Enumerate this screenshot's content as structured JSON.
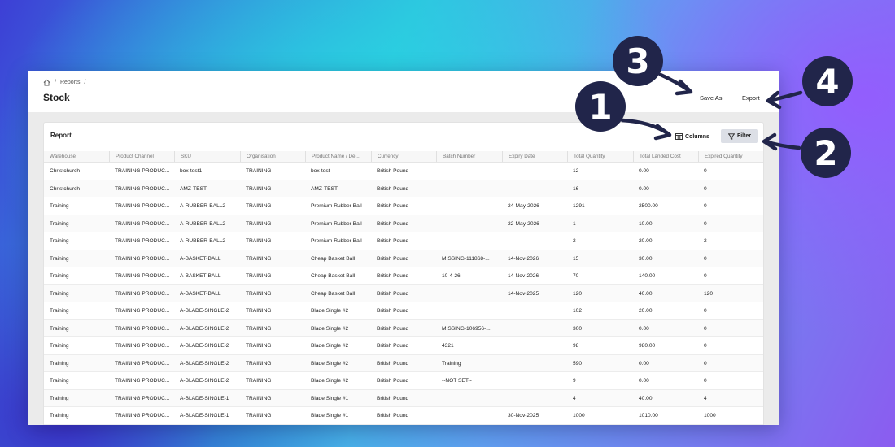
{
  "breadcrumb": {
    "reports": "Reports",
    "sep1": "/",
    "sep2": "/"
  },
  "page": {
    "title": "Stock"
  },
  "header_actions": {
    "save_as": "Save As",
    "export": "Export"
  },
  "report": {
    "title": "Report",
    "columns_label": "Columns",
    "filter_label": "Filter"
  },
  "table": {
    "headers": [
      "Warehouse",
      "Product Channel",
      "SKU",
      "Organisation",
      "Product Name / De...",
      "Currency",
      "Batch Number",
      "Expiry Date",
      "Total Quantity",
      "Total Landed Cost",
      "Expired Quantity"
    ],
    "rows": [
      [
        "Christchurch",
        "TRAINING PRODUC...",
        "box-test1",
        "TRAINING",
        "box-test",
        "British Pound",
        "",
        "",
        "12",
        "0.00",
        "0"
      ],
      [
        "Christchurch",
        "TRAINING PRODUC...",
        "AMZ-TEST",
        "TRAINING",
        "AMZ-TEST",
        "British Pound",
        "",
        "",
        "16",
        "0.00",
        "0"
      ],
      [
        "Training",
        "TRAINING PRODUC...",
        "A-RUBBER-BALL2",
        "TRAINING",
        "Premium Rubber Ball",
        "British Pound",
        "",
        "24-May-2026",
        "1291",
        "2500.00",
        "0"
      ],
      [
        "Training",
        "TRAINING PRODUC...",
        "A-RUBBER-BALL2",
        "TRAINING",
        "Premium Rubber Ball",
        "British Pound",
        "",
        "22-May-2026",
        "1",
        "10.00",
        "0"
      ],
      [
        "Training",
        "TRAINING PRODUC...",
        "A-RUBBER-BALL2",
        "TRAINING",
        "Premium Rubber Ball",
        "British Pound",
        "",
        "",
        "2",
        "20.00",
        "2"
      ],
      [
        "Training",
        "TRAINING PRODUC...",
        "A-BASKET-BALL",
        "TRAINING",
        "Cheap Basket Ball",
        "British Pound",
        "MISSING-111868-...",
        "14-Nov-2026",
        "15",
        "30.00",
        "0"
      ],
      [
        "Training",
        "TRAINING PRODUC...",
        "A-BASKET-BALL",
        "TRAINING",
        "Cheap Basket Ball",
        "British Pound",
        "10-4-26",
        "14-Nov-2026",
        "70",
        "140.00",
        "0"
      ],
      [
        "Training",
        "TRAINING PRODUC...",
        "A-BASKET-BALL",
        "TRAINING",
        "Cheap Basket Ball",
        "British Pound",
        "",
        "14-Nov-2025",
        "120",
        "40.00",
        "120"
      ],
      [
        "Training",
        "TRAINING PRODUC...",
        "A-BLADE-SINGLE-2",
        "TRAINING",
        "Blade Single #2",
        "British Pound",
        "",
        "",
        "102",
        "20.00",
        "0"
      ],
      [
        "Training",
        "TRAINING PRODUC...",
        "A-BLADE-SINGLE-2",
        "TRAINING",
        "Blade Single #2",
        "British Pound",
        "MISSING-106956-...",
        "",
        "300",
        "0.00",
        "0"
      ],
      [
        "Training",
        "TRAINING PRODUC...",
        "A-BLADE-SINGLE-2",
        "TRAINING",
        "Blade Single #2",
        "British Pound",
        "4321",
        "",
        "98",
        "980.00",
        "0"
      ],
      [
        "Training",
        "TRAINING PRODUC...",
        "A-BLADE-SINGLE-2",
        "TRAINING",
        "Blade Single #2",
        "British Pound",
        "Training",
        "",
        "590",
        "0.00",
        "0"
      ],
      [
        "Training",
        "TRAINING PRODUC...",
        "A-BLADE-SINGLE-2",
        "TRAINING",
        "Blade Single #2",
        "British Pound",
        "--NOT SET--",
        "",
        "9",
        "0.00",
        "0"
      ],
      [
        "Training",
        "TRAINING PRODUC...",
        "A-BLADE-SINGLE-1",
        "TRAINING",
        "Blade Single #1",
        "British Pound",
        "",
        "",
        "4",
        "40.00",
        "4"
      ],
      [
        "Training",
        "TRAINING PRODUC...",
        "A-BLADE-SINGLE-1",
        "TRAINING",
        "Blade Single #1",
        "British Pound",
        "",
        "30-Nov-2025",
        "1000",
        "1010.00",
        "1000"
      ]
    ]
  },
  "callouts": {
    "one": "1",
    "two": "2",
    "three": "3",
    "four": "4"
  },
  "icons": {
    "home": "home-icon",
    "columns": "columns-icon",
    "filter": "filter-icon"
  },
  "colors": {
    "badge": "#21254a",
    "filter_bg": "#dcdfe6"
  }
}
